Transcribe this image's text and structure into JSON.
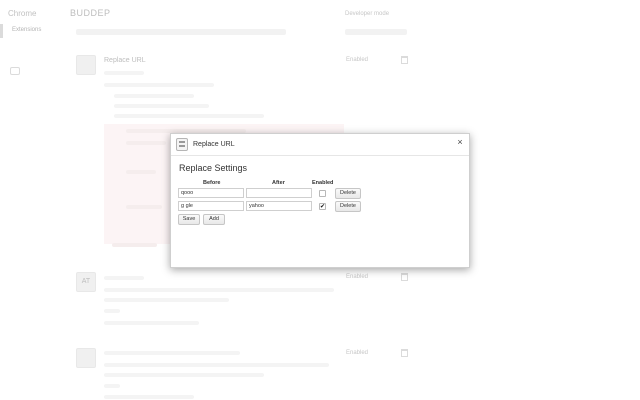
{
  "background": {
    "sidebar": {
      "title": "Chrome",
      "active_item": "Extensions"
    },
    "page_title": "BUDDEP",
    "developer_mode": "Developer mode",
    "extension": {
      "icon_text": "",
      "name": "Replace URL",
      "enabled_label": "Enabled"
    },
    "extension_2": {
      "icon_text": "AT",
      "enabled_label": "Enabled"
    },
    "extension_3": {
      "icon_text": "",
      "enabled_label": "Enabled"
    }
  },
  "dialog": {
    "title": "Replace URL",
    "close_glyph": "×",
    "settings_title": "Replace Settings",
    "columns": {
      "before": "Before",
      "after": "After",
      "enabled": "Enabled"
    },
    "rows": [
      {
        "before": "qooo",
        "after": "",
        "enabled": false,
        "delete_label": "Delete"
      },
      {
        "before": "g gle",
        "after": "yahoo",
        "enabled": true,
        "delete_label": "Delete"
      }
    ],
    "save_label": "Save",
    "add_label": "Add",
    "check_glyph": "✔"
  }
}
